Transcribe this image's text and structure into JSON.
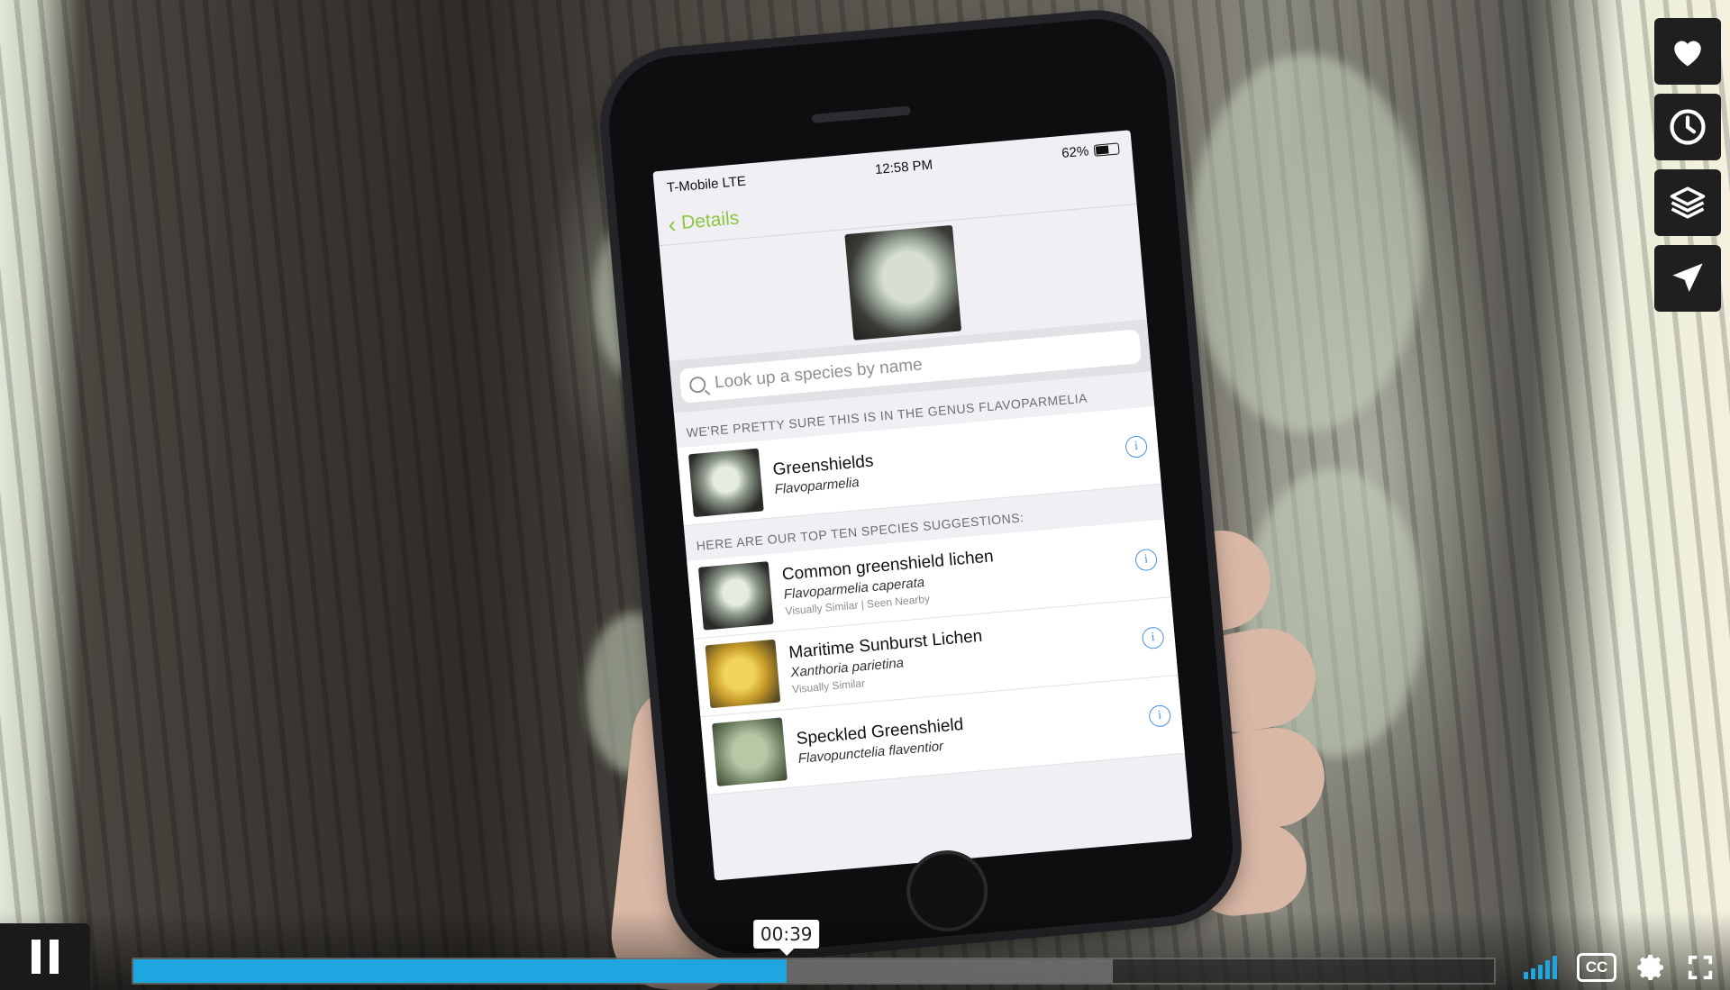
{
  "phone": {
    "status": {
      "carrier": "T-Mobile  LTE",
      "time": "12:58 PM",
      "battery": "62%"
    },
    "nav": {
      "back_label": "Details"
    },
    "search": {
      "placeholder": "Look up a species by name"
    },
    "genus_header": "WE'RE PRETTY SURE THIS IS IN THE GENUS FLAVOPARMELIA",
    "genus_item": {
      "name": "Greenshields",
      "scientific": "Flavoparmelia"
    },
    "suggestions_header": "HERE ARE OUR TOP TEN SPECIES SUGGESTIONS:",
    "suggestions": [
      {
        "name": "Common greenshield lichen",
        "scientific": "Flavoparmelia caperata",
        "note": "Visually Similar | Seen Nearby"
      },
      {
        "name": "Maritime Sunburst Lichen",
        "scientific": "Xanthoria parietina",
        "note": "Visually Similar"
      },
      {
        "name": "Speckled Greenshield",
        "scientific": "Flavopunctelia flaventior",
        "note": ""
      }
    ]
  },
  "sidebar": {
    "buttons": [
      {
        "icon": "heart-icon"
      },
      {
        "icon": "clock-icon"
      },
      {
        "icon": "layers-icon"
      },
      {
        "icon": "send-icon"
      }
    ]
  },
  "player": {
    "timestamp": "00:39",
    "progress_played": 0.48,
    "progress_buffered": 0.72,
    "accent_color": "#1fa6e0",
    "cc_label": "CC"
  }
}
